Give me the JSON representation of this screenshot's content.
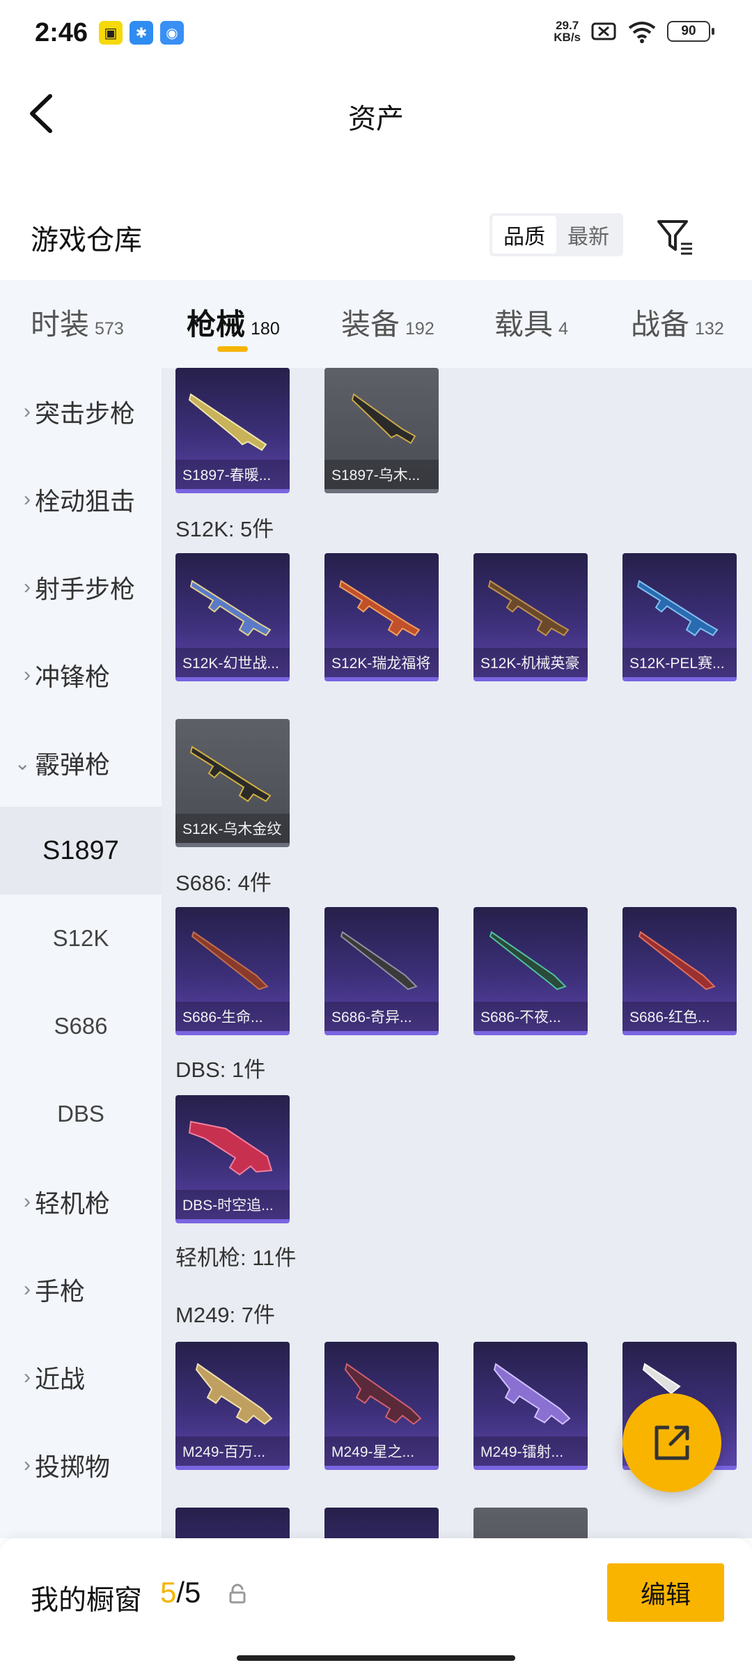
{
  "status": {
    "time": "2:46",
    "speed_value": "29.7",
    "speed_unit": "KB/s",
    "battery": "90"
  },
  "header": {
    "title": "资产"
  },
  "warehouse": {
    "title": "游戏仓库",
    "sort_options": [
      "品质",
      "最新"
    ]
  },
  "tabs": [
    {
      "label": "时装",
      "count": "573"
    },
    {
      "label": "枪械",
      "count": "180"
    },
    {
      "label": "装备",
      "count": "192"
    },
    {
      "label": "载具",
      "count": "4"
    },
    {
      "label": "战备",
      "count": "132"
    }
  ],
  "sidebar": {
    "categories": [
      "突击步枪",
      "栓动狙击",
      "射手步枪",
      "冲锋枪",
      "霰弹枪",
      "轻机枪",
      "手枪",
      "近战",
      "投掷物"
    ],
    "subs": [
      "S1897",
      "S12K",
      "S686",
      "DBS"
    ]
  },
  "groups": {
    "s12k_title": "S12K: 5件",
    "s686_title": "S686: 4件",
    "dbs_title": "DBS: 1件",
    "lmg_title": "轻机枪: 11件",
    "m249_title": "M249: 7件"
  },
  "cards": {
    "s1897": [
      "S1897-春暖...",
      "S1897-乌木..."
    ],
    "s12k": [
      "S12K-幻世战...",
      "S12K-瑞龙福将",
      "S12K-机械英豪",
      "S12K-PEL赛...",
      "S12K-乌木金纹"
    ],
    "s686": [
      "S686-生命...",
      "S686-奇异...",
      "S686-不夜...",
      "S686-红色..."
    ],
    "dbs": [
      "DBS-时空追..."
    ],
    "m249": [
      "M249-百万...",
      "M249-星之...",
      "M249-镭射..."
    ]
  },
  "bottom": {
    "showcase_label": "我的橱窗",
    "current": "5",
    "total": "/5",
    "edit_label": "编辑"
  },
  "colors": {
    "accent": "#f9b400",
    "card_purple": "#3c2f78",
    "card_gray": "#55575f"
  }
}
